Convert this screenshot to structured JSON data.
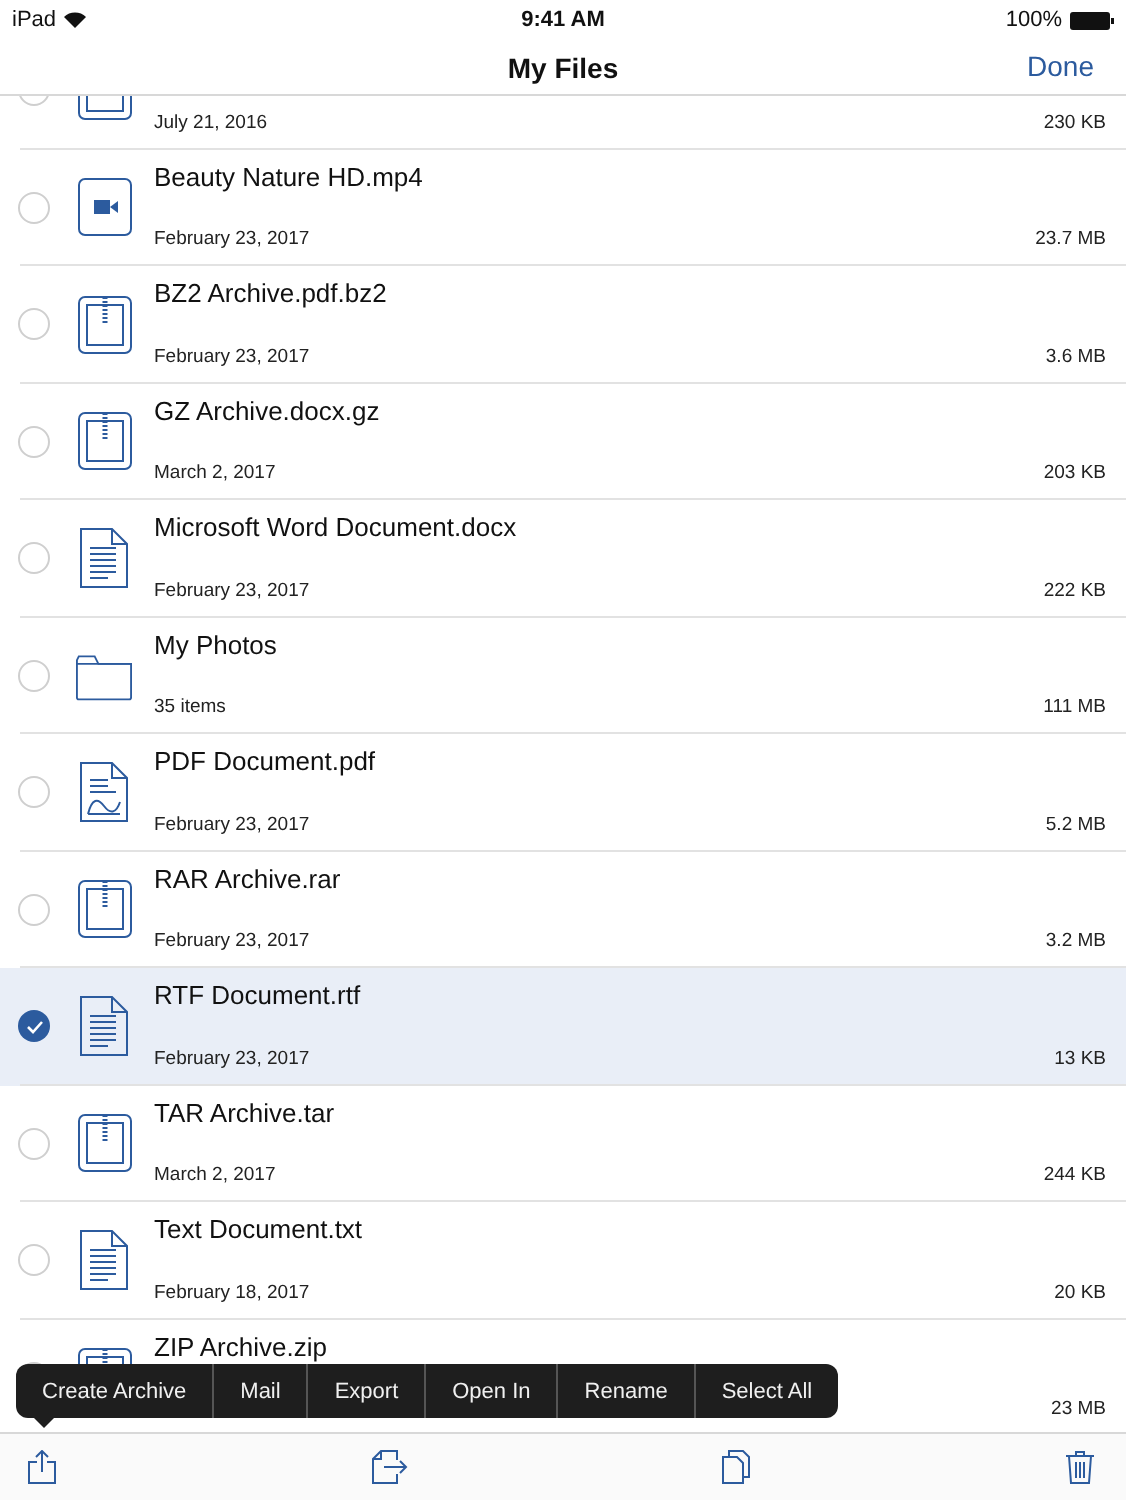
{
  "status_bar": {
    "device": "iPad",
    "time": "9:41 AM",
    "battery": "100%"
  },
  "nav": {
    "title": "My Files",
    "done": "Done"
  },
  "files": [
    {
      "kind": "archive",
      "date": "July 21, 2016",
      "size": "230 KB",
      "selected": false
    },
    {
      "name": "Beauty Nature HD.mp4",
      "kind": "video",
      "date": "February 23, 2017",
      "size": "23.7 MB",
      "selected": false
    },
    {
      "name": "BZ2 Archive.pdf.bz2",
      "kind": "archive",
      "date": "February 23, 2017",
      "size": "3.6 MB",
      "selected": false
    },
    {
      "name": "GZ Archive.docx.gz",
      "kind": "archive",
      "date": "March 2, 2017",
      "size": "203 KB",
      "selected": false
    },
    {
      "name": "Microsoft Word Document.docx",
      "kind": "document",
      "date": "February 23, 2017",
      "size": "222 KB",
      "selected": false
    },
    {
      "name": "My Photos",
      "kind": "folder",
      "date": "35 items",
      "size": "111 MB",
      "selected": false
    },
    {
      "name": "PDF Document.pdf",
      "kind": "pdf",
      "date": "February 23, 2017",
      "size": "5.2 MB",
      "selected": false
    },
    {
      "name": "RAR Archive.rar",
      "kind": "archive",
      "date": "February 23, 2017",
      "size": "3.2 MB",
      "selected": false
    },
    {
      "name": "RTF Document.rtf",
      "kind": "document",
      "date": "February 23, 2017",
      "size": "13 KB",
      "selected": true
    },
    {
      "name": "TAR Archive.tar",
      "kind": "archive",
      "date": "March 2, 2017",
      "size": "244 KB",
      "selected": false
    },
    {
      "name": "Text Document.txt",
      "kind": "document",
      "date": "February 18, 2017",
      "size": "20 KB",
      "selected": false
    },
    {
      "name": "ZIP Archive.zip",
      "kind": "archive",
      "size": "23 MB",
      "selected": false
    }
  ],
  "menu": [
    "Create Archive",
    "Mail",
    "Export",
    "Open In",
    "Rename",
    "Select All"
  ]
}
